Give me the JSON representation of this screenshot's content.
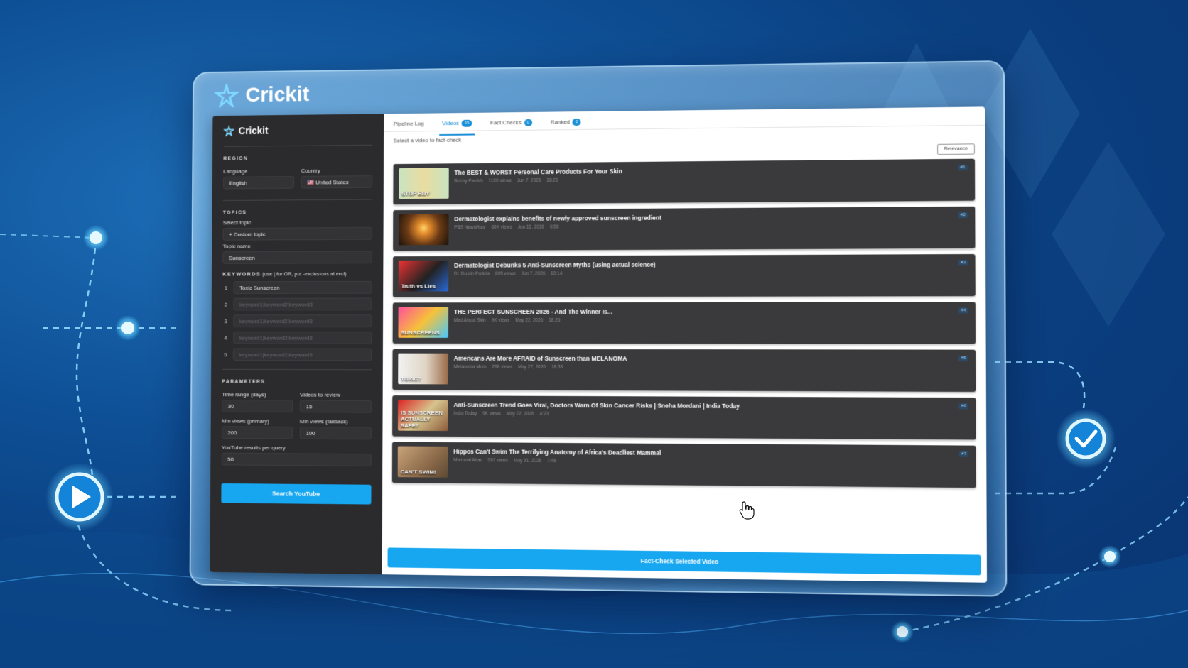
{
  "brand": {
    "name": "Crickit"
  },
  "sidebar": {
    "brand_name": "Crickit",
    "region": {
      "title": "REGION",
      "language_label": "Language",
      "language_value": "English",
      "country_label": "Country",
      "country_value": "🇺🇸 United States"
    },
    "topics": {
      "title": "TOPICS",
      "select_label": "Select topic",
      "select_value": "+ Custom topic",
      "name_label": "Topic name",
      "name_value": "Sunscreen"
    },
    "keywords": {
      "title": "KEYWORDS",
      "hint": "(use | for OR, put -exclusions at end)",
      "rows": [
        {
          "num": "1",
          "value": "Toxic Sunscreen",
          "placeholder": ""
        },
        {
          "num": "2",
          "value": "",
          "placeholder": "keyword1|keyword2|keyword3"
        },
        {
          "num": "3",
          "value": "",
          "placeholder": "keyword1|keyword2|keyword3"
        },
        {
          "num": "4",
          "value": "",
          "placeholder": "keyword1|keyword2|keyword3"
        },
        {
          "num": "5",
          "value": "",
          "placeholder": "keyword1|keyword2|keyword3"
        }
      ]
    },
    "parameters": {
      "title": "PARAMETERS",
      "time_range_label": "Time range (days)",
      "time_range_value": "30",
      "videos_review_label": "Videos to review",
      "videos_review_value": "15",
      "min_views_primary_label": "Min views (primary)",
      "min_views_primary_value": "200",
      "min_views_fallback_label": "Min views (fallback)",
      "min_views_fallback_value": "100",
      "results_label": "YouTube results per query",
      "results_value": "50"
    },
    "search_button": "Search YouTube"
  },
  "main": {
    "tabs": [
      {
        "label": "Pipeline Log",
        "badge": ""
      },
      {
        "label": "Videos",
        "badge": "15"
      },
      {
        "label": "Fact Checks",
        "badge": "0"
      },
      {
        "label": "Ranked",
        "badge": "0"
      }
    ],
    "subhead": "Select a video to fact-check",
    "sort_label": "Relevance",
    "videos": [
      {
        "title": "The BEST & WORST Personal Care Products For Your Skin",
        "channel": "Bobby Parrish",
        "views": "112K views",
        "date": "Jun 7, 2026",
        "duration": "18:23",
        "rank": "#1",
        "thumb_text": "STOP  BUY"
      },
      {
        "title": "Dermatologist explains benefits of newly approved sunscreen ingredient",
        "channel": "PBS NewsHour",
        "views": "60K views",
        "date": "Jun 15, 2026",
        "duration": "6:56",
        "rank": "#2",
        "thumb_text": ""
      },
      {
        "title": "Dermatologist Debunks 5 Anti-Sunscreen Myths (using actual science)",
        "channel": "Dr. Dustin Portela",
        "views": "895 views",
        "date": "Jun 7, 2026",
        "duration": "10:14",
        "rank": "#3",
        "thumb_text": "Truth vs Lies"
      },
      {
        "title": "THE PERFECT SUNSCREEN 2026 - And The Winner Is...",
        "channel": "Mad About Skin",
        "views": "9K views",
        "date": "May 22, 2026",
        "duration": "18:26",
        "rank": "#4",
        "thumb_text": "SUNSCREENS"
      },
      {
        "title": "Americans Are More AFRAID of Sunscreen than MELANOMA",
        "channel": "Melanoma Mom",
        "views": "298 views",
        "date": "May 27, 2026",
        "duration": "18:33",
        "rank": "#5",
        "thumb_text": "TOXIC?"
      },
      {
        "title": "Anti-Sunscreen Trend Goes Viral, Doctors Warn Of Skin Cancer Risks | Sneha Mordani | India Today",
        "channel": "India Today",
        "views": "9K views",
        "date": "May 22, 2026",
        "duration": "4:23",
        "rank": "#6",
        "thumb_text": "IS SUNSCREEN ACTUALLY SAFE?"
      },
      {
        "title": "Hippos Can't Swim The Terrifying Anatomy of Africa's Deadliest Mammal",
        "channel": "Mammal Atlas",
        "views": "567 views",
        "date": "May 31, 2026",
        "duration": "7:48",
        "rank": "#7",
        "thumb_text": "CAN'T SWIM!"
      }
    ],
    "fact_check_button": "Fact-Check Selected Video"
  },
  "colors": {
    "accent": "#16a7f0",
    "sidebar_bg": "#2b2b2d",
    "card_bg": "#3a3a3c"
  }
}
